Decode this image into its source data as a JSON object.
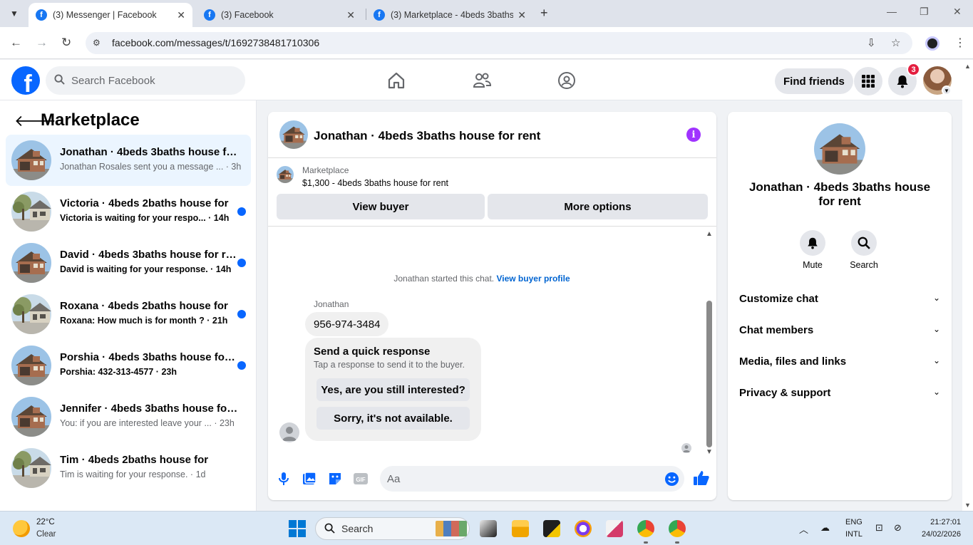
{
  "browser": {
    "tabs": [
      {
        "label": "(3) Messenger | Facebook",
        "active": true
      },
      {
        "label": "(3) Facebook",
        "active": false
      },
      {
        "label": "(3) Marketplace - 4beds 3baths",
        "active": false
      }
    ],
    "url": "facebook.com/messages/t/1692738481710306"
  },
  "fbnav": {
    "logo_letter": "f",
    "search_placeholder": "Search Facebook",
    "find_friends": "Find friends",
    "notifications_count": "3"
  },
  "sidebar": {
    "title": "Marketplace",
    "threads": [
      {
        "title": "Jonathan · 4beds 3baths house for rent",
        "subtitle": "Jonathan Rosales sent you a message ... · 3h",
        "unread": false,
        "active": true,
        "house": "brick"
      },
      {
        "title": "Victoria · 4beds 2baths house for",
        "subtitle": "Victoria is waiting for your respo... · 14h",
        "unread": true,
        "active": false,
        "house": "tree"
      },
      {
        "title": "David · 4beds 3baths house for rent",
        "subtitle": "David is waiting for your response. · 14h",
        "unread": true,
        "active": false,
        "house": "brick"
      },
      {
        "title": "Roxana · 4beds 2baths house for",
        "subtitle": "Roxana: How much is for month ? · 21h",
        "unread": true,
        "active": false,
        "house": "tree"
      },
      {
        "title": "Porshia · 4beds 3baths house for rent",
        "subtitle": "Porshia: 432-313-4577 · 23h",
        "unread": true,
        "active": false,
        "house": "brick"
      },
      {
        "title": "Jennifer · 4beds 3baths house for rent",
        "subtitle": "You: if you are interested leave your ... · 23h",
        "unread": false,
        "active": false,
        "house": "brick"
      },
      {
        "title": "Tim · 4beds 2baths house for",
        "subtitle": "Tim is waiting for your response. · 1d",
        "unread": false,
        "active": false,
        "house": "tree"
      }
    ]
  },
  "chat": {
    "title": "Jonathan · 4beds 3baths house for rent",
    "marketplace_label": "Marketplace",
    "listing": "$1,300 - 4beds 3baths house for rent",
    "view_buyer": "View buyer",
    "more_options": "More options",
    "started_text": "Jonathan started this chat.",
    "view_buyer_profile": "View buyer profile",
    "sender_name": "Jonathan",
    "phone_message": "956-974-3484",
    "quick_title": "Send a quick response",
    "quick_subtitle": "Tap a response to send it to the buyer.",
    "quick_replies": [
      "Yes, are you still interested?",
      "Sorry, it's not available."
    ],
    "composer_placeholder": "Aa"
  },
  "details": {
    "title": "Jonathan · 4beds 3baths house for rent",
    "mute": "Mute",
    "search": "Search",
    "sections": [
      "Customize chat",
      "Chat members",
      "Media, files and links",
      "Privacy & support"
    ]
  },
  "taskbar": {
    "temperature": "22°C",
    "condition": "Clear",
    "search_placeholder": "Search",
    "lang1": "ENG",
    "lang2": "INTL",
    "time": "21:27:01",
    "date": "24/02/2026"
  },
  "colors": {
    "fb_blue": "#0866ff",
    "unread_dot": "#0866ff",
    "active_thread": "#ebf5ff",
    "info_purple": "#a033ff",
    "badge_red": "#e41e3f"
  }
}
